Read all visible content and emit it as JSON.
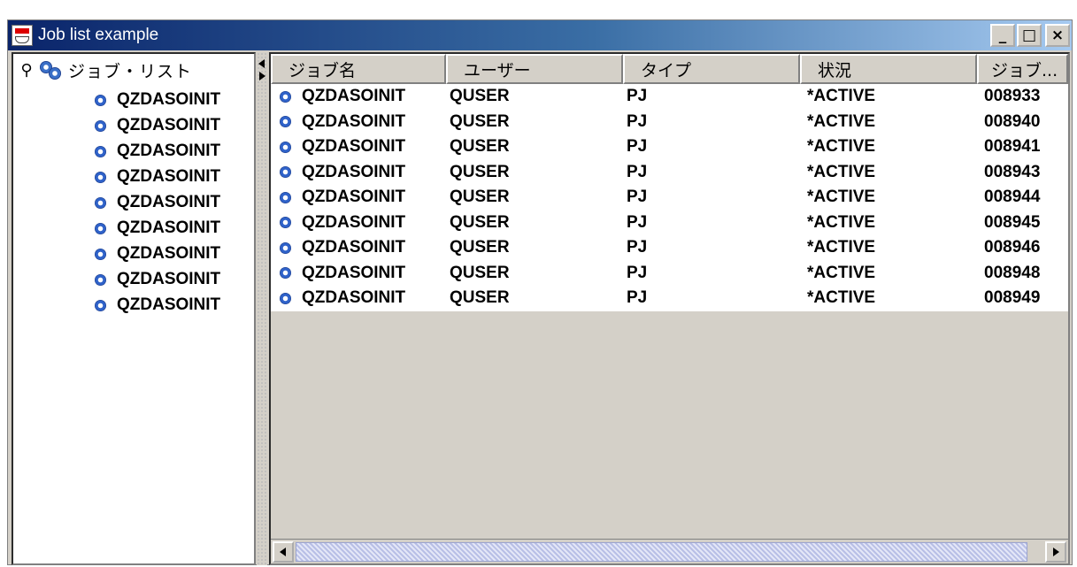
{
  "window": {
    "title": "Job list example",
    "minimize": "_",
    "maximize": "□",
    "close": "×"
  },
  "tree": {
    "root_label": "ジョブ・リスト",
    "items": [
      "QZDASOINIT",
      "QZDASOINIT",
      "QZDASOINIT",
      "QZDASOINIT",
      "QZDASOINIT",
      "QZDASOINIT",
      "QZDASOINIT",
      "QZDASOINIT",
      "QZDASOINIT"
    ]
  },
  "table": {
    "headers": [
      "ジョブ名",
      "ユーザー",
      "タイプ",
      "状況",
      "ジョブ..."
    ],
    "rows": [
      [
        "QZDASOINIT",
        "QUSER",
        "PJ",
        "*ACTIVE",
        "008933"
      ],
      [
        "QZDASOINIT",
        "QUSER",
        "PJ",
        "*ACTIVE",
        "008940"
      ],
      [
        "QZDASOINIT",
        "QUSER",
        "PJ",
        "*ACTIVE",
        "008941"
      ],
      [
        "QZDASOINIT",
        "QUSER",
        "PJ",
        "*ACTIVE",
        "008943"
      ],
      [
        "QZDASOINIT",
        "QUSER",
        "PJ",
        "*ACTIVE",
        "008944"
      ],
      [
        "QZDASOINIT",
        "QUSER",
        "PJ",
        "*ACTIVE",
        "008945"
      ],
      [
        "QZDASOINIT",
        "QUSER",
        "PJ",
        "*ACTIVE",
        "008946"
      ],
      [
        "QZDASOINIT",
        "QUSER",
        "PJ",
        "*ACTIVE",
        "008948"
      ],
      [
        "QZDASOINIT",
        "QUSER",
        "PJ",
        "*ACTIVE",
        "008949"
      ]
    ]
  },
  "colors": {
    "titlebar_start": "#0a246a",
    "titlebar_end": "#a6caf0",
    "chrome": "#d4d0c8"
  }
}
